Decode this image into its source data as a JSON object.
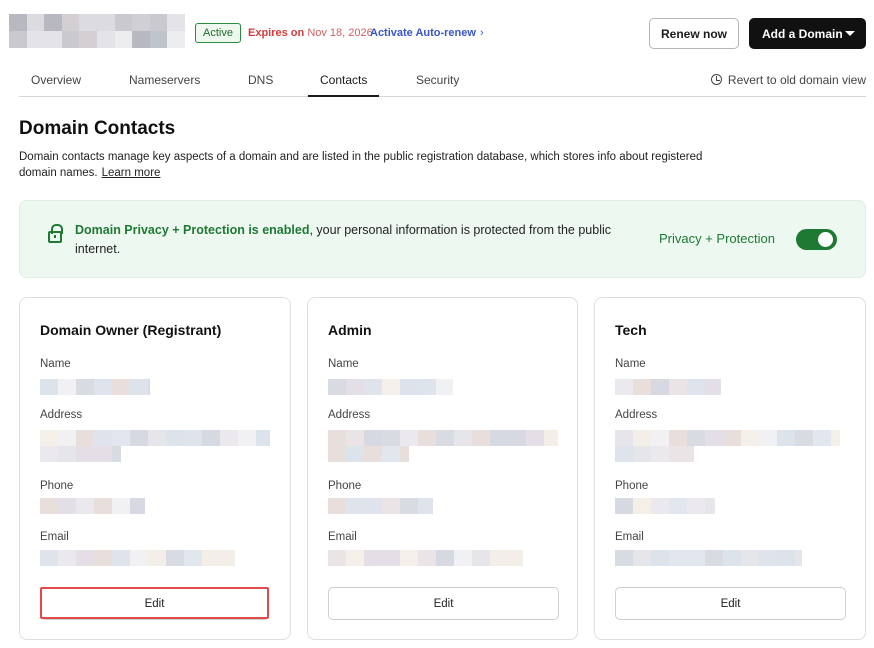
{
  "header": {
    "status": "Active",
    "expires_label": "Expires on",
    "expires_date": "Nov 18, 2026",
    "auto_renew": "Activate Auto-renew",
    "renew_button": "Renew now",
    "add_domain_button": "Add a Domain"
  },
  "tabs": {
    "items": [
      "Overview",
      "Nameservers",
      "DNS",
      "Contacts",
      "Security"
    ],
    "active": "Contacts",
    "revert": "Revert to old domain view"
  },
  "page": {
    "title": "Domain Contacts",
    "description": "Domain contacts manage key aspects of a domain and are listed in the public registration database, which stores info about registered domain names.",
    "learn_more": "Learn more"
  },
  "privacy": {
    "strong": "Domain Privacy + Protection is enabled",
    "rest": ", your personal information is protected from the public internet.",
    "label": "Privacy + Protection",
    "enabled": true
  },
  "contacts": {
    "field_labels": {
      "name": "Name",
      "address": "Address",
      "phone": "Phone",
      "email": "Email"
    },
    "edit_label": "Edit",
    "cards": [
      {
        "title": "Domain Owner (Registrant)"
      },
      {
        "title": "Admin"
      },
      {
        "title": "Tech"
      }
    ]
  },
  "colors": {
    "accent_green": "#1e7a33",
    "privacy_bg": "#edf8f0",
    "expiry_red": "#d23c3c",
    "link_blue": "#3a56c8",
    "primary_dark": "#111111",
    "highlight_red": "#e04a4a"
  }
}
